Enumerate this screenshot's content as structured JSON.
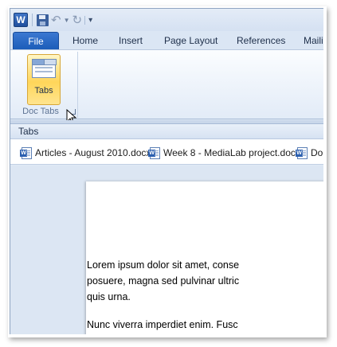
{
  "qat": {
    "app_icon_letter": "W",
    "icons": [
      "word-app-icon",
      "save-icon",
      "undo-icon",
      "dropdown-arrow-icon",
      "redo-icon",
      "customize-qat-icon"
    ]
  },
  "ribbon_tabs": {
    "file": "File",
    "items": [
      "Home",
      "Insert",
      "Page Layout",
      "References",
      "Maili"
    ]
  },
  "ribbon": {
    "tabs_button_label": "Tabs",
    "group_label": "Doc Tabs"
  },
  "tabs_pane": {
    "title": "Tabs",
    "documents": [
      "Articles - August 2010.docx",
      "Week 8 - MediaLab project.docx",
      "Do"
    ]
  },
  "document": {
    "paragraphs": [
      [
        "Lorem ipsum dolor sit amet, conse",
        "posuere, magna sed pulvinar ultric",
        "quis urna."
      ],
      [
        "Nunc viverra imperdiet enim. Fusc"
      ]
    ]
  },
  "colors": {
    "file_tab": "#1a5bb8",
    "selected_button": "#ffd65a",
    "ribbon_bg": "#dfe9f5"
  }
}
